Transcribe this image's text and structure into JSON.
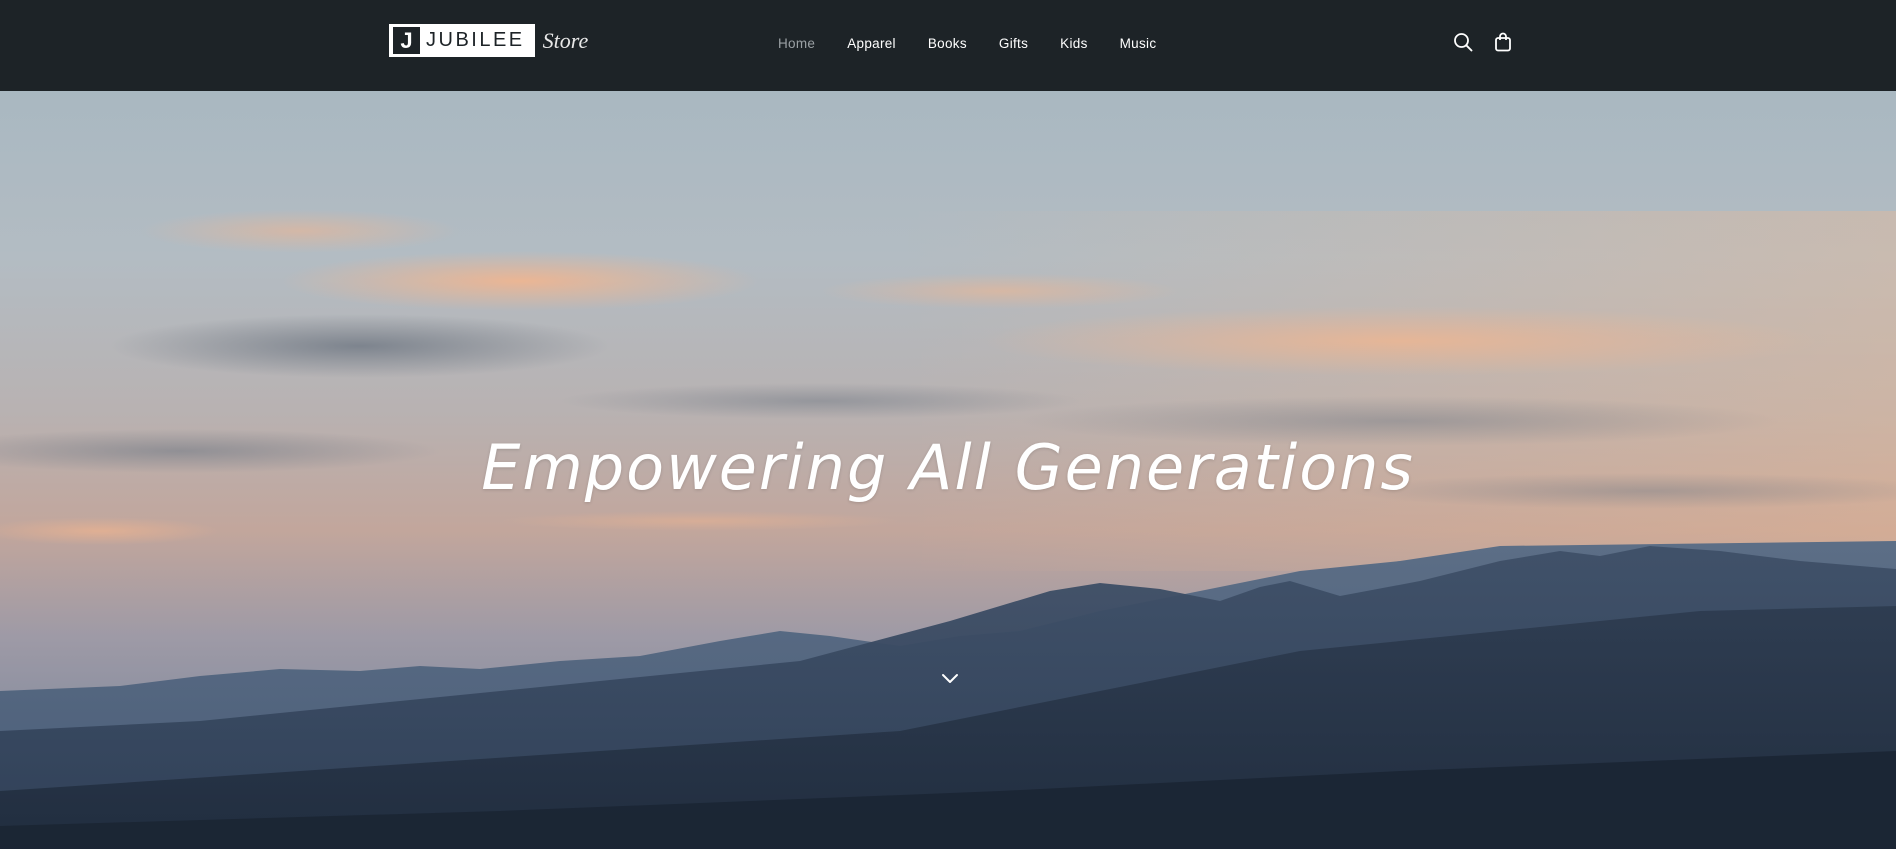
{
  "header": {
    "logo": {
      "mark": "J",
      "wordmark": "JUBILEE",
      "store": "Store"
    },
    "nav": [
      {
        "label": "Home",
        "active": true
      },
      {
        "label": "Apparel",
        "active": false
      },
      {
        "label": "Books",
        "active": false
      },
      {
        "label": "Gifts",
        "active": false
      },
      {
        "label": "Kids",
        "active": false
      },
      {
        "label": "Music",
        "active": false
      }
    ],
    "icons": {
      "search": "search-icon",
      "cart": "shopping-bag-icon"
    }
  },
  "hero": {
    "heading": "Empowering All Generations",
    "scroll_icon": "chevron-down-icon"
  },
  "colors": {
    "header_bg": "#1d2327",
    "nav_active": "#9aa0a4",
    "nav_text": "#ffffff"
  }
}
